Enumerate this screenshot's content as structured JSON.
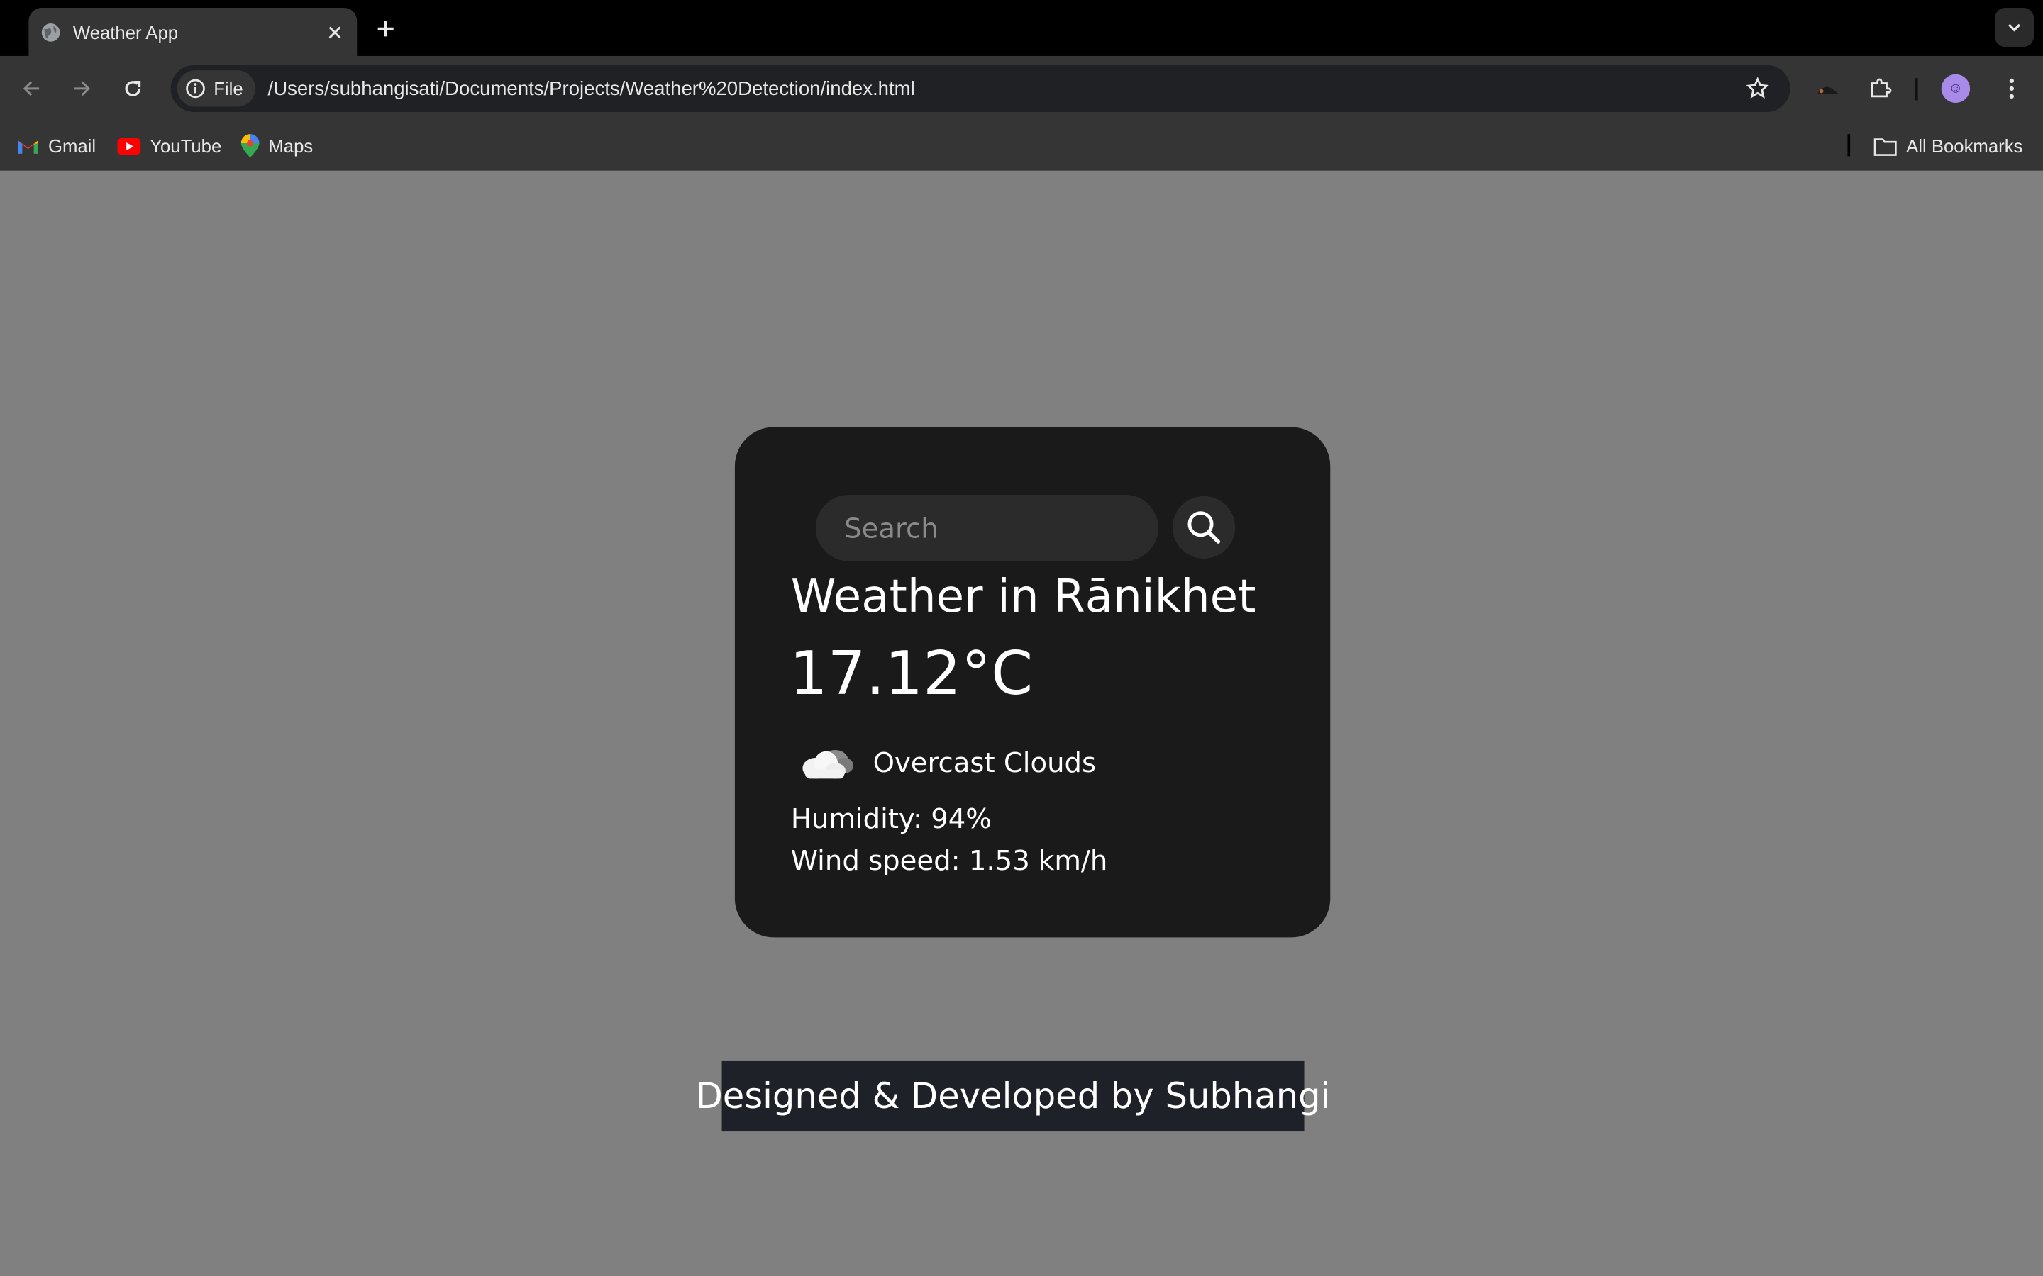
{
  "browser": {
    "tab_title": "Weather App",
    "omnibox_chip": "File",
    "url": "/Users/subhangisati/Documents/Projects/Weather%20Detection/index.html",
    "bookmarks": [
      {
        "label": "Gmail",
        "icon": "gmail-icon"
      },
      {
        "label": "YouTube",
        "icon": "youtube-icon"
      },
      {
        "label": "Maps",
        "icon": "maps-icon"
      }
    ],
    "all_bookmarks": "All Bookmarks"
  },
  "weather": {
    "search_placeholder": "Search",
    "city": "Weather in Rānikhet",
    "temperature": "17.12°C",
    "icon": "cloud-icon",
    "description": "Overcast Clouds",
    "humidity": "Humidity: 94%",
    "wind": "Wind speed: 1.53 km/h"
  },
  "footer": {
    "credit": "Designed & Developed by Subhangi"
  },
  "colors": {
    "page_bg": "#808080",
    "card_bg": "#1a1a1a",
    "footer_bg": "#1e2228"
  }
}
